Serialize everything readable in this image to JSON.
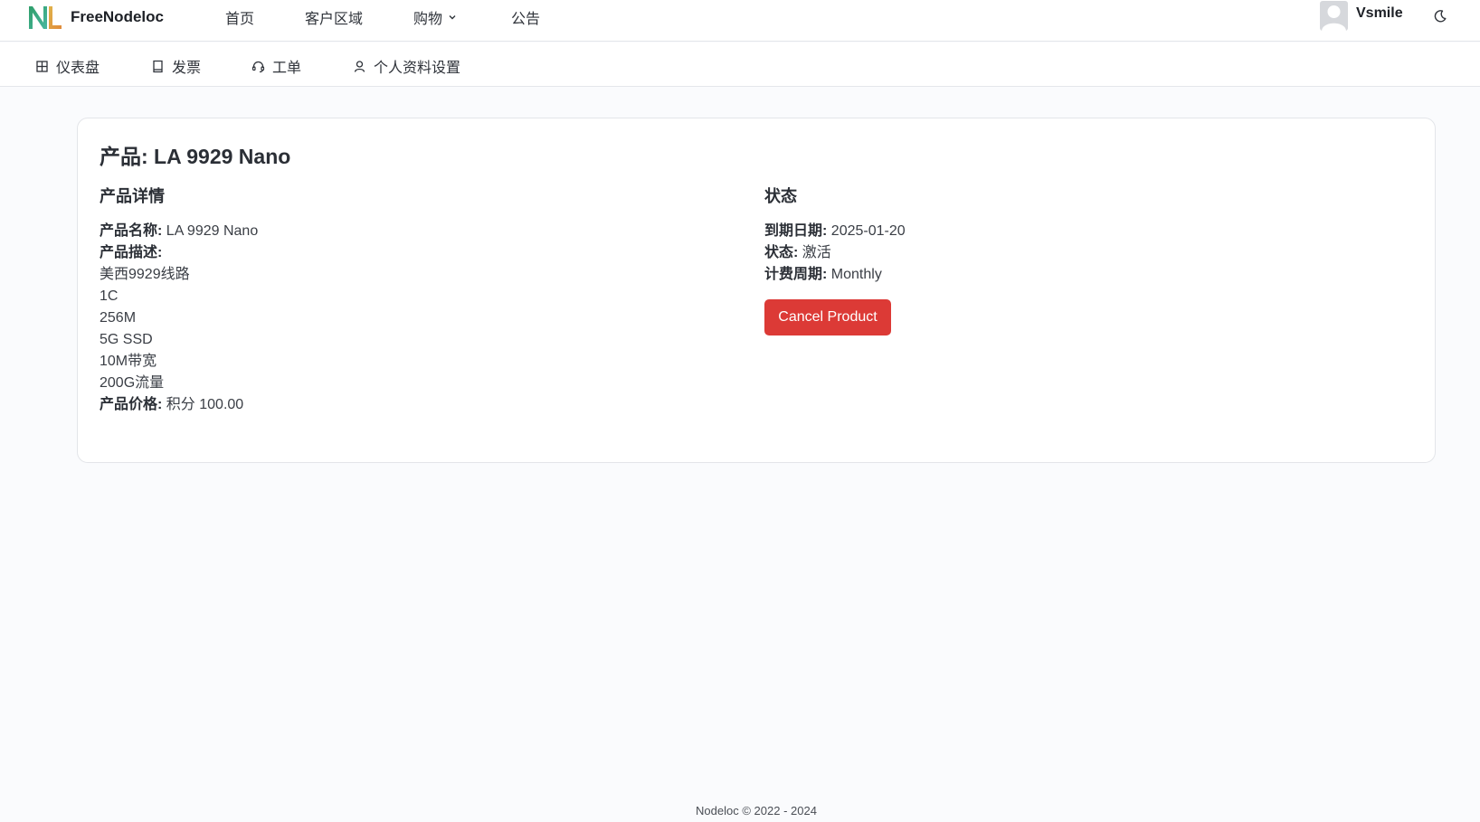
{
  "header": {
    "brand": "FreeNodeloc",
    "nav": [
      {
        "label": "首页"
      },
      {
        "label": "客户区域"
      },
      {
        "label": "购物"
      },
      {
        "label": "公告"
      }
    ],
    "user_name": "Vsmile"
  },
  "subnav": {
    "items": [
      {
        "label": "仪表盘",
        "icon": "grid-icon"
      },
      {
        "label": "发票",
        "icon": "invoice-icon"
      },
      {
        "label": "工单",
        "icon": "headset-icon"
      },
      {
        "label": "个人资料设置",
        "icon": "user-icon"
      }
    ]
  },
  "product": {
    "title": "产品: LA 9929 Nano",
    "details_heading": "产品详情",
    "name_label": "产品名称:",
    "name_value": "LA 9929 Nano",
    "desc_label": "产品描述:",
    "desc_lines": [
      "美西9929线路",
      "1C",
      "256M",
      "5G SSD",
      "10M带宽",
      "200G流量"
    ],
    "price_label": "产品价格:",
    "price_value": "积分 100.00",
    "status_heading": "状态",
    "expiry_label": "到期日期:",
    "expiry_value": "2025-01-20",
    "status_label": "状态:",
    "status_value": "激活",
    "cycle_label": "计费周期:",
    "cycle_value": "Monthly",
    "cancel_label": "Cancel Product"
  },
  "footer": {
    "text": "Nodeloc © 2022 - 2024"
  },
  "colors": {
    "danger": "#dc3a36",
    "background": "#fafbfd"
  }
}
